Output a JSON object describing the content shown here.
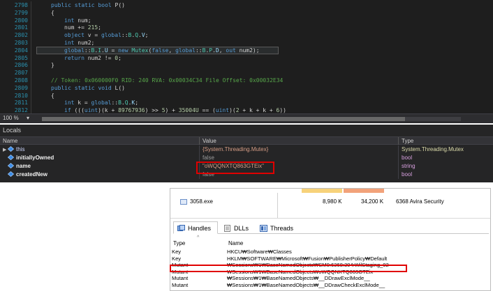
{
  "editor": {
    "lines": [
      {
        "num": "2798",
        "indent": 1,
        "parts": [
          [
            "kw",
            "public static "
          ],
          [
            "kw",
            "bool "
          ],
          [
            "id",
            "P()"
          ]
        ]
      },
      {
        "num": "2799",
        "indent": 1,
        "parts": [
          [
            "id",
            "{"
          ]
        ]
      },
      {
        "num": "2800",
        "indent": 2,
        "parts": [
          [
            "kw",
            "int "
          ],
          [
            "id",
            "num;"
          ]
        ]
      },
      {
        "num": "2801",
        "indent": 2,
        "parts": [
          [
            "id",
            "num += "
          ],
          [
            "num",
            "215"
          ],
          [
            "id",
            ";"
          ]
        ]
      },
      {
        "num": "2802",
        "indent": 2,
        "parts": [
          [
            "kw",
            "object "
          ],
          [
            "id",
            "v = "
          ],
          [
            "kw",
            "global"
          ],
          [
            "id",
            "::"
          ],
          [
            "ty",
            "B"
          ],
          [
            "id",
            "."
          ],
          [
            "ty",
            "Q"
          ],
          [
            "id",
            "."
          ],
          [
            "ref",
            "V"
          ],
          [
            "id",
            ";"
          ]
        ]
      },
      {
        "num": "2803",
        "indent": 2,
        "parts": [
          [
            "kw",
            "int "
          ],
          [
            "id",
            "num2;"
          ]
        ]
      },
      {
        "num": "2804",
        "indent": 2,
        "parts": [
          [
            "kw",
            "global"
          ],
          [
            "id",
            "::"
          ],
          [
            "ty",
            "B"
          ],
          [
            "id",
            "."
          ],
          [
            "ty",
            "I"
          ],
          [
            "id",
            "."
          ],
          [
            "ref",
            "U"
          ],
          [
            "id",
            " = "
          ],
          [
            "kw",
            "new "
          ],
          [
            "ty",
            "Mutex"
          ],
          [
            "id",
            "("
          ],
          [
            "kw",
            "false"
          ],
          [
            "id",
            ", "
          ],
          [
            "kw",
            "global"
          ],
          [
            "id",
            "::"
          ],
          [
            "ty",
            "B"
          ],
          [
            "id",
            "."
          ],
          [
            "ty",
            "P"
          ],
          [
            "id",
            "."
          ],
          [
            "ref",
            "D"
          ],
          [
            "id",
            ", "
          ],
          [
            "kw",
            "out "
          ],
          [
            "id",
            "num2);"
          ]
        ],
        "highlight": true
      },
      {
        "num": "2805",
        "indent": 2,
        "parts": [
          [
            "kw",
            "return "
          ],
          [
            "id",
            "num2 != "
          ],
          [
            "num",
            "0"
          ],
          [
            "id",
            ";"
          ]
        ]
      },
      {
        "num": "2806",
        "indent": 1,
        "parts": [
          [
            "id",
            "}"
          ]
        ]
      },
      {
        "num": "2807",
        "indent": 0,
        "parts": [
          [
            "id",
            ""
          ]
        ]
      },
      {
        "num": "2808",
        "indent": 1,
        "parts": [
          [
            "cm",
            "// Token: 0x060000F0 RID: 240 RVA: 0x00034C34 File Offset: 0x00032E34"
          ]
        ]
      },
      {
        "num": "2809",
        "indent": 1,
        "parts": [
          [
            "kw",
            "public static "
          ],
          [
            "kw",
            "void "
          ],
          [
            "id",
            "L()"
          ]
        ]
      },
      {
        "num": "2810",
        "indent": 1,
        "parts": [
          [
            "id",
            "{"
          ]
        ]
      },
      {
        "num": "2811",
        "indent": 2,
        "parts": [
          [
            "kw",
            "int "
          ],
          [
            "id",
            "k = "
          ],
          [
            "kw",
            "global"
          ],
          [
            "id",
            "::"
          ],
          [
            "ty",
            "B"
          ],
          [
            "id",
            "."
          ],
          [
            "ty",
            "Q"
          ],
          [
            "id",
            "."
          ],
          [
            "ref",
            "K"
          ],
          [
            "id",
            ";"
          ]
        ]
      },
      {
        "num": "2812",
        "indent": 2,
        "parts": [
          [
            "kw",
            "if "
          ],
          [
            "id",
            "((("
          ],
          [
            "kw",
            "uint"
          ],
          [
            "id",
            ")(k + "
          ],
          [
            "num",
            "89767936"
          ],
          [
            "id",
            ") >> "
          ],
          [
            "num",
            "5"
          ],
          [
            "id",
            ") + "
          ],
          [
            "num",
            "35004U"
          ],
          [
            "id",
            " == ("
          ],
          [
            "kw",
            "uint"
          ],
          [
            "id",
            ")("
          ],
          [
            "num",
            "2"
          ],
          [
            "id",
            " + k + k + "
          ],
          [
            "num",
            "6"
          ],
          [
            "id",
            "))"
          ]
        ]
      }
    ],
    "zoom": "100 %",
    "zoom_arrow": "▾"
  },
  "locals": {
    "title": "Locals",
    "columns": [
      "Name",
      "Value",
      "Type"
    ],
    "rows": [
      {
        "name": "this",
        "value": "{System.Threading.Mutex}",
        "type": "System.Threading.Mutex",
        "expandable": true
      },
      {
        "name": "initiallyOwned",
        "value": "false",
        "type": "bool",
        "expandable": false
      },
      {
        "name": "name",
        "value": "\"oWQQNXTQ863GTEix\"",
        "type": "string",
        "expandable": false
      },
      {
        "name": "createdNew",
        "value": "false",
        "type": "bool",
        "expandable": false
      }
    ]
  },
  "process_explorer": {
    "process": {
      "name": "3058.exe",
      "private_bytes": "8,980 K",
      "working_set": "34,200 K",
      "pid_desc": "6368 Avira Security"
    },
    "tabs": [
      {
        "label": "Handles",
        "active": true
      },
      {
        "label": "DLLs",
        "active": false
      },
      {
        "label": "Threads",
        "active": false
      }
    ],
    "columns": [
      "Type",
      "Name"
    ],
    "sort_glyph": "^",
    "handles": [
      {
        "type": "Key",
        "name": "HKCU₩Software₩Classes"
      },
      {
        "type": "Key",
        "name": "HKLM₩SOFTWARE₩Microsoft₩Fusion₩PublisherPolicy₩Default"
      },
      {
        "type": "Mutant",
        "name": "₩Sessions₩1₩BaseNamedObjects₩SM0:6368:304:WilStaging_02"
      },
      {
        "type": "Mutant",
        "name": "₩Sessions₩1₩BaseNamedObjects₩oWQQNXTQ863GTEix"
      },
      {
        "type": "Mutant",
        "name": "₩Sessions₩1₩BaseNamedObjects₩__DDrawExclMode__"
      },
      {
        "type": "Mutant",
        "name": "₩Sessions₩1₩BaseNamedObjects₩__DDrawCheckExclMode__"
      }
    ]
  },
  "colors": {
    "highlight_box": "#e00000",
    "editor_bg": "#1e1e1e",
    "keyword": "#569cd6",
    "type": "#4ec9b0"
  }
}
